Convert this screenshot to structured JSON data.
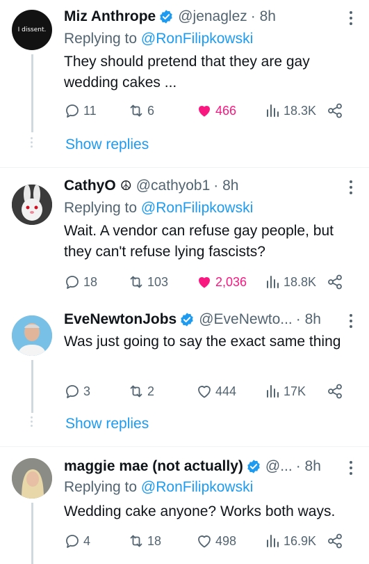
{
  "tweets": [
    {
      "name": "Miz Anthrope",
      "handle": "@jenaglez",
      "time": "· 8h",
      "avatar_text": "I dissent.",
      "reply_prefix": "Replying to",
      "reply_to": "@RonFilipkowski",
      "text": "They should pretend that they are gay wedding cakes ...",
      "replies": "11",
      "retweets": "6",
      "likes": "466",
      "views": "18.3K",
      "liked": true,
      "show_replies": "Show replies"
    },
    {
      "name": "CathyO",
      "peace_symbol": "☮",
      "handle": "@cathyob1",
      "time": "· 8h",
      "reply_prefix": "Replying to",
      "reply_to": "@RonFilipkowski",
      "text": "Wait. A vendor can refuse gay people, but they can't refuse lying fascists?",
      "replies": "18",
      "retweets": "103",
      "likes": "2,036",
      "views": "18.8K",
      "liked": true
    },
    {
      "name": "EveNewtonJobs",
      "handle": "@EveNewto...",
      "time": "· 8h",
      "text": "Was just going to say the exact same thing",
      "replies": "3",
      "retweets": "2",
      "likes": "444",
      "views": "17K",
      "liked": false,
      "show_replies": "Show replies"
    },
    {
      "name": "maggie mae (not actually)",
      "handle": "@...",
      "time": "· 8h",
      "reply_prefix": "Replying to",
      "reply_to": "@RonFilipkowski",
      "text": "Wedding cake anyone? Works both ways.",
      "replies": "4",
      "retweets": "18",
      "likes": "498",
      "views": "16.9K",
      "liked": false
    }
  ],
  "colors": {
    "accent": "#1d9bf0",
    "like": "#f91880",
    "secondary": "#536471",
    "text": "#0f1419"
  }
}
